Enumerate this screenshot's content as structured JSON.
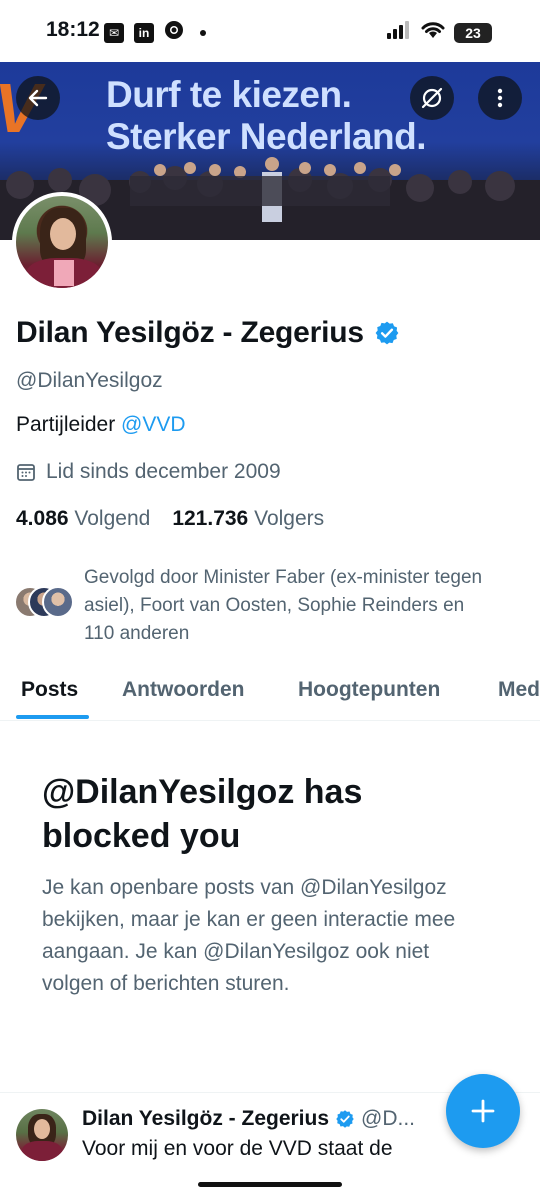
{
  "status_bar": {
    "time": "18:12",
    "app_icons": [
      "notification-app-icon",
      "linkedin-icon",
      "chrome-icon"
    ],
    "battery": "23"
  },
  "banner": {
    "line1": "Durf te kiezen.",
    "line2": "Sterker Nederland.",
    "logo_text": "V"
  },
  "profile": {
    "display_name": "Dilan Yesilgöz - Zegerius",
    "handle": "@DilanYesilgoz",
    "bio_text": "Partijleider ",
    "bio_mention": "@VVD",
    "joined": "Lid sinds december 2009",
    "following_count": "4.086",
    "following_label": "Volgend",
    "followers_count": "121.736",
    "followers_label": "Volgers",
    "followed_by": "Gevolgd door Minister Faber (ex-minister tegen asiel), Foort van Oosten, Sophie Reinders en 110 anderen"
  },
  "tabs": [
    {
      "label": "Posts",
      "active": true
    },
    {
      "label": "Antwoorden",
      "active": false
    },
    {
      "label": "Hoogtepunten",
      "active": false
    },
    {
      "label": "Media",
      "active": false
    }
  ],
  "blocked": {
    "title": "@DilanYesilgoz has blocked you",
    "description": "Je kan openbare posts van @DilanYesilgoz bekijken, maar je kan er geen interactie mee aangaan. Je kan @DilanYesilgoz ook niet volgen of berichten sturen."
  },
  "tweet": {
    "name": "Dilan Yesilgöz - Zegerius",
    "handle": "@D...",
    "text": "Voor mij en voor de VVD staat de"
  },
  "colors": {
    "accent": "#1d9bf0",
    "text_primary": "#0f1419",
    "text_secondary": "#536471",
    "banner_blue": "#223f9e"
  }
}
